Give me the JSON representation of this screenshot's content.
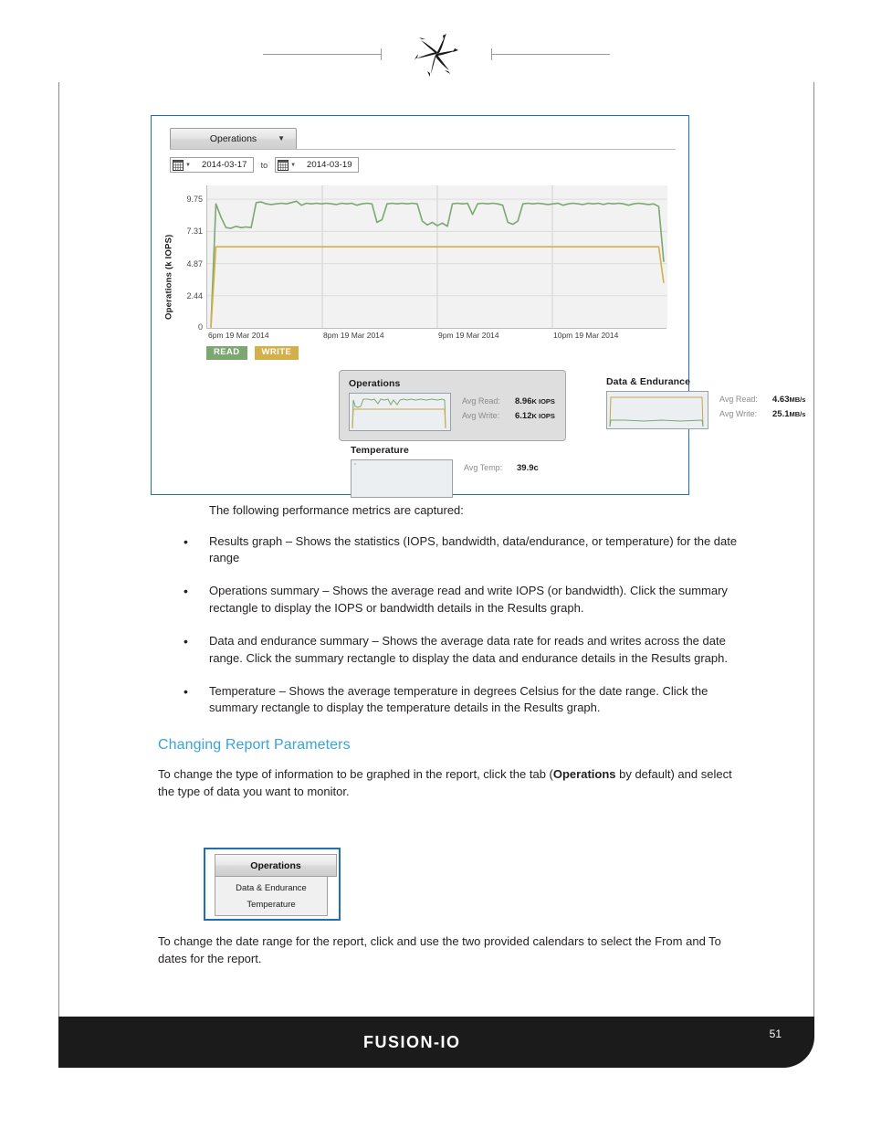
{
  "header": {
    "logo_icon": "pinwheel-star-logo"
  },
  "screenshot": {
    "tab": {
      "label": "Operations",
      "caret_icon": "chevron-down-icon"
    },
    "date_range": {
      "from_icon": "calendar-icon",
      "from_value": "2014-03-17",
      "to_label": "to",
      "to_icon": "calendar-icon",
      "to_value": "2014-03-19"
    },
    "legend": [
      {
        "label": "READ",
        "color": "#7ba870"
      },
      {
        "label": "WRITE",
        "color": "#d4b04a"
      }
    ],
    "cards": {
      "operations": {
        "title": "Operations",
        "rows": [
          {
            "label": "Avg Read:",
            "value": "8.96",
            "unit": "K IOPS"
          },
          {
            "label": "Avg Write:",
            "value": "6.12",
            "unit": "K IOPS"
          }
        ]
      },
      "data_endurance": {
        "title": "Data & Endurance",
        "rows": [
          {
            "label": "Avg Read:",
            "value": "4.63",
            "unit": "MB/s"
          },
          {
            "label": "Avg Write:",
            "value": "25.1",
            "unit": "MB/s"
          }
        ]
      },
      "temperature": {
        "title": "Temperature",
        "rows": [
          {
            "label": "Avg Temp:",
            "value": "39.9c",
            "unit": ""
          }
        ]
      }
    }
  },
  "chart_data": {
    "type": "line",
    "title": "",
    "xlabel": "",
    "ylabel": "Operations (k IOPS)",
    "ylim": [
      0,
      10.8
    ],
    "yticks": [
      9.75,
      7.31,
      4.87,
      2.44,
      0
    ],
    "ytick_labels": [
      "9.75",
      "7.31",
      "4.87",
      "2.44",
      "0"
    ],
    "xtick_labels": [
      "6pm 19 Mar 2014",
      "8pm 19 Mar 2014",
      "9pm 19 Mar 2014",
      "10pm 19 Mar 2014"
    ],
    "grid": true,
    "legend_position": "below-left",
    "series": [
      {
        "name": "READ",
        "color": "#7ba870",
        "values": [
          0.1,
          9.4,
          8.4,
          7.6,
          7.55,
          7.7,
          7.6,
          7.65,
          7.6,
          9.5,
          9.55,
          9.4,
          9.35,
          9.4,
          9.45,
          9.4,
          9.5,
          9.6,
          9.3,
          9.45,
          9.4,
          9.45,
          9.4,
          9.45,
          9.4,
          9.35,
          9.45,
          9.4,
          9.45,
          9.3,
          9.4,
          9.45,
          9.4,
          8.0,
          8.2,
          9.4,
          9.45,
          9.4,
          9.45,
          9.4,
          9.45,
          9.4,
          8.1,
          7.8,
          8.0,
          7.75,
          7.95,
          7.7,
          9.4,
          9.45,
          9.4,
          9.45,
          8.6,
          9.4,
          9.45,
          9.4,
          9.45,
          9.4,
          9.3,
          8.0,
          7.85,
          8.1,
          9.4,
          9.45,
          9.4,
          9.45,
          9.4,
          9.35,
          9.4,
          9.45,
          9.3,
          9.4,
          9.45,
          9.4,
          9.35,
          9.45,
          9.4,
          9.45,
          9.35,
          9.45,
          9.4,
          9.45,
          9.4,
          9.3,
          9.4,
          9.45,
          9.4,
          9.35,
          9.4,
          9.2,
          5.0
        ]
      },
      {
        "name": "WRITE",
        "color": "#d4b04a",
        "values": [
          0.0,
          6.15,
          6.15,
          6.15,
          6.15,
          6.15,
          6.15,
          6.15,
          6.15,
          6.15,
          6.15,
          6.15,
          6.15,
          6.15,
          6.15,
          6.15,
          6.15,
          6.15,
          6.15,
          6.15,
          6.15,
          6.15,
          6.15,
          6.15,
          6.15,
          6.15,
          6.15,
          6.15,
          6.15,
          6.15,
          6.15,
          6.15,
          6.15,
          6.15,
          6.15,
          6.15,
          6.15,
          6.15,
          6.15,
          6.15,
          6.15,
          6.15,
          6.15,
          6.15,
          6.15,
          6.15,
          6.15,
          6.15,
          6.15,
          6.15,
          6.15,
          6.15,
          6.15,
          6.15,
          6.15,
          6.15,
          6.15,
          6.15,
          6.15,
          6.15,
          6.15,
          6.15,
          6.15,
          6.15,
          6.15,
          6.15,
          6.15,
          6.15,
          6.15,
          6.15,
          6.15,
          6.15,
          6.15,
          6.15,
          6.15,
          6.15,
          6.15,
          6.15,
          6.15,
          6.15,
          6.15,
          6.15,
          6.15,
          6.15,
          6.15,
          6.15,
          6.15,
          6.15,
          6.15,
          6.15,
          3.4
        ]
      }
    ]
  },
  "doc": {
    "intro": "The following performance metrics are captured:",
    "bullets": [
      "Results graph – Shows the statistics (IOPS, bandwidth, data/endurance, or temperature) for the date range",
      "Operations summary – Shows the average read and write IOPS (or bandwidth). Click the summary rectangle to display the IOPS or bandwidth details in the Results graph.",
      "Data and endurance summary – Shows the average data rate for reads and writes across the date range. Click the summary rectangle to display the data and endurance details in the Results graph.",
      "Temperature – Shows the average temperature in degrees Celsius for the date range. Click the summary rectangle to display the temperature details in the Results graph."
    ],
    "section_heading": "Changing Report Parameters",
    "para_before_prefix": "To change the type of information to be graphed in the report, click the tab (",
    "para_before_bold": "Operations",
    "para_before_suffix": " by default) and select the type of data you want to monitor.",
    "para_after": "To change the date range for the report, click and use the two provided calendars to select the From and To dates for the report."
  },
  "dropdown_figure": {
    "header": "Operations",
    "items": [
      "Data & Endurance",
      "Temperature"
    ]
  },
  "footer": {
    "brand": "FUSION-IO",
    "page_number": "51"
  }
}
